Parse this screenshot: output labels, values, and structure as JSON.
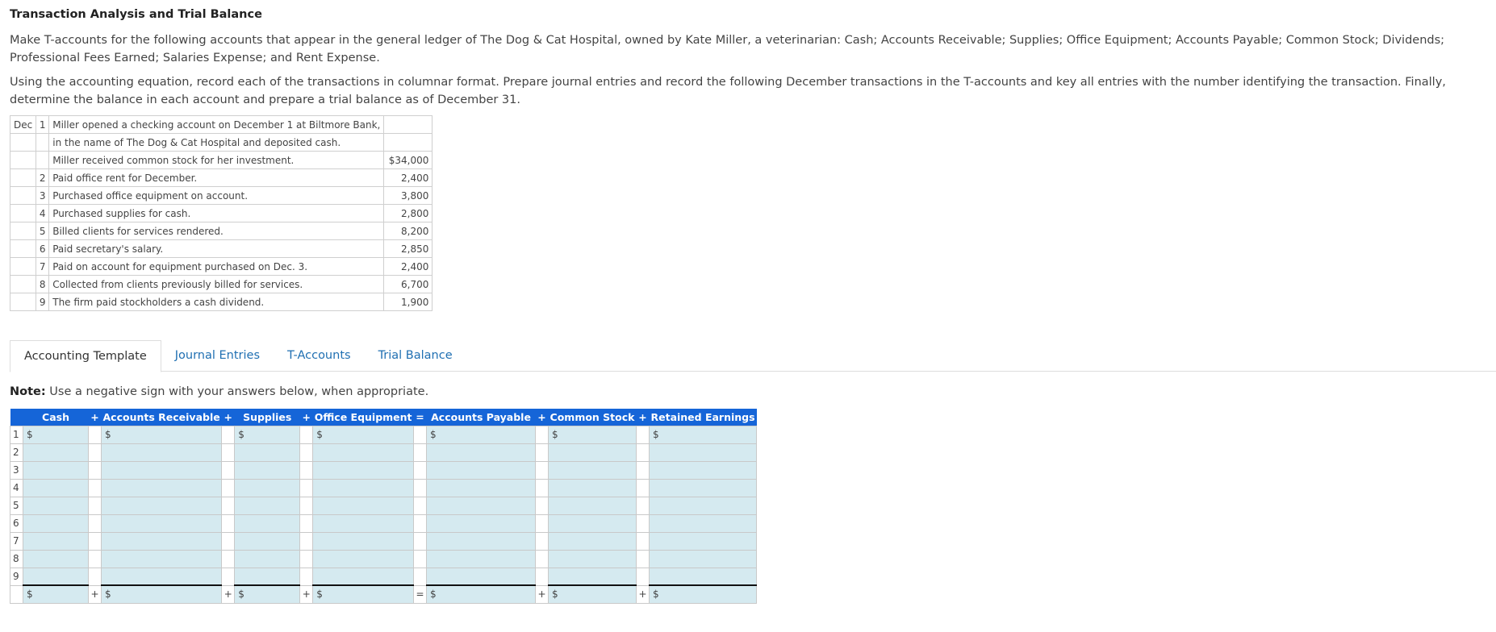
{
  "page": {
    "title": "Transaction Analysis and Trial Balance",
    "paragraphs": [
      "Make T-accounts for the following accounts that appear in the general ledger of The Dog & Cat Hospital, owned by Kate Miller, a veterinarian: Cash; Accounts Receivable; Supplies; Office Equipment; Accounts Payable; Common Stock; Dividends; Professional Fees Earned; Salaries Expense; and Rent Expense.",
      "Using the accounting equation, record each of the transactions in columnar format. Prepare journal entries and record the following December transactions in the T-accounts and key all entries with the number identifying the transaction. Finally, determine the balance in each account and prepare a trial balance as of December 31."
    ]
  },
  "transactions": [
    {
      "month": "Dec",
      "num": "1",
      "desc": "Miller opened a checking account on December 1 at Biltmore Bank,",
      "amount": ""
    },
    {
      "month": "",
      "num": "",
      "desc": "in the name of The Dog & Cat Hospital and deposited cash.",
      "amount": ""
    },
    {
      "month": "",
      "num": "",
      "desc": "Miller received common stock for her investment.",
      "amount": "$34,000"
    },
    {
      "month": "",
      "num": "2",
      "desc": "Paid office rent for December.",
      "amount": "2,400"
    },
    {
      "month": "",
      "num": "3",
      "desc": "Purchased office equipment on account.",
      "amount": "3,800"
    },
    {
      "month": "",
      "num": "4",
      "desc": "Purchased supplies for cash.",
      "amount": "2,800"
    },
    {
      "month": "",
      "num": "5",
      "desc": "Billed clients for services rendered.",
      "amount": "8,200"
    },
    {
      "month": "",
      "num": "6",
      "desc": "Paid secretary's salary.",
      "amount": "2,850"
    },
    {
      "month": "",
      "num": "7",
      "desc": "Paid on account for equipment purchased on Dec. 3.",
      "amount": "2,400"
    },
    {
      "month": "",
      "num": "8",
      "desc": "Collected from clients previously billed for services.",
      "amount": "6,700"
    },
    {
      "month": "",
      "num": "9",
      "desc": "The firm paid stockholders a cash dividend.",
      "amount": "1,900"
    }
  ],
  "tabs": [
    {
      "label": "Accounting Template",
      "active": true
    },
    {
      "label": "Journal Entries",
      "active": false
    },
    {
      "label": "T-Accounts",
      "active": false
    },
    {
      "label": "Trial Balance",
      "active": false
    }
  ],
  "note": {
    "bold": "Note:",
    "text": " Use a negative sign with your answers below, when appropriate."
  },
  "template": {
    "columns": [
      "Cash",
      "Accounts Receivable",
      "Supplies",
      "Office Equipment",
      "Accounts Payable",
      "Common Stock",
      "Retained Earnings"
    ],
    "operators": [
      "+",
      "+",
      "+",
      "=",
      "+",
      "+"
    ],
    "rows": [
      "1",
      "2",
      "3",
      "4",
      "5",
      "6",
      "7",
      "8",
      "9"
    ],
    "currency_symbol": "$",
    "colors": {
      "header_bg": "#1565d8",
      "cell_bg": "#d5eaf0"
    }
  }
}
